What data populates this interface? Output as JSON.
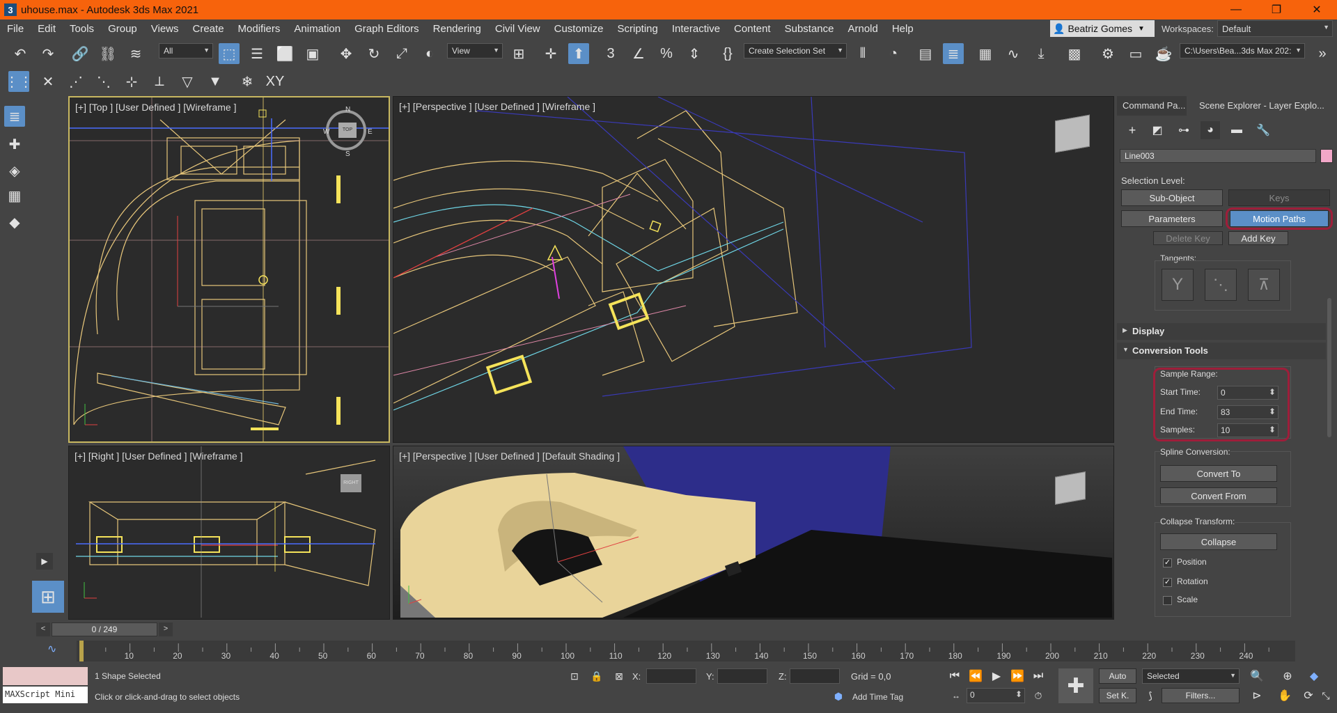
{
  "window": {
    "title": "uhouse.max - Autodesk 3ds Max 2021",
    "app_icon": "3",
    "controls": [
      "—",
      "❐",
      "✕"
    ]
  },
  "menu": [
    "File",
    "Edit",
    "Tools",
    "Group",
    "Views",
    "Create",
    "Modifiers",
    "Animation",
    "Graph Editors",
    "Rendering",
    "Civil View",
    "Customize",
    "Scripting",
    "Interactive",
    "Content",
    "Substance",
    "Arnold",
    "Help"
  ],
  "user": {
    "name": "Beatriz Gomes",
    "icon": "user-icon"
  },
  "workspaces": {
    "label": "Workspaces:",
    "value": "Default"
  },
  "toolbar": {
    "selection_filter": "All",
    "ref_coord": "View",
    "selection_set": "Create Selection Set",
    "path": "C:\\Users\\Bea...3ds Max 202:",
    "xy_label": "XY"
  },
  "viewports": {
    "top": "[+] [Top ] [User Defined ] [Wireframe ]",
    "persp_wire": "[+] [Perspective ] [User Defined ] [Wireframe ]",
    "right": "[+] [Right ] [User Defined ] [Wireframe ]",
    "persp_shaded": "[+] [Perspective ] [User Defined ] [Default Shading ]",
    "compass": {
      "n": "N",
      "s": "S",
      "w": "W",
      "e": "E",
      "cube_top": "TOP"
    },
    "cube_right": "RIGHT"
  },
  "command_panel": {
    "tabs": [
      "Command Pa...",
      "Scene Explorer - Layer Explo..."
    ],
    "object_name": "Line003",
    "object_color": "#f2a7c8",
    "selection_level_label": "Selection Level:",
    "sub_object": "Sub-Object",
    "keys": "Keys",
    "parameters": "Parameters",
    "motion_paths": "Motion Paths",
    "delete_key": "Delete Key",
    "add_key": "Add Key",
    "tangents_label": "Tangents:",
    "display_rollout": "Display",
    "conversion_rollout": "Conversion Tools",
    "sample_range_label": "Sample Range:",
    "start_time_label": "Start Time:",
    "start_time": "0",
    "end_time_label": "End Time:",
    "end_time": "83",
    "samples_label": "Samples:",
    "samples": "10",
    "spline_conversion_label": "Spline Conversion:",
    "convert_to": "Convert To",
    "convert_from": "Convert From",
    "collapse_transform_label": "Collapse Transform:",
    "collapse": "Collapse",
    "position": "Position",
    "rotation": "Rotation",
    "scale": "Scale",
    "position_checked": true,
    "rotation_checked": true,
    "scale_checked": false
  },
  "timeline": {
    "frame_display": "0 / 249",
    "ticks": [
      "10",
      "20",
      "30",
      "40",
      "50",
      "60",
      "70",
      "80",
      "90",
      "100",
      "110",
      "120",
      "130",
      "140",
      "150",
      "160",
      "170",
      "180",
      "190",
      "200",
      "210",
      "220",
      "230",
      "240"
    ]
  },
  "status": {
    "maxscript": "MAXScript Mini",
    "selection": "1 Shape Selected",
    "prompt": "Click or click-and-drag to select objects",
    "x_label": "X:",
    "y_label": "Y:",
    "z_label": "Z:",
    "grid": "Grid = 0,0",
    "add_time_tag": "Add Time Tag",
    "auto": "Auto",
    "set_key": "Set K.",
    "key_filter": "Selected",
    "filters": "Filters...",
    "current_frame": "0"
  }
}
